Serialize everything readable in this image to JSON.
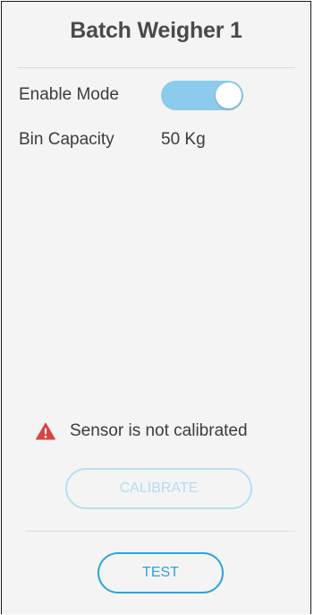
{
  "panel": {
    "title": "Batch Weigher 1"
  },
  "settings": {
    "enable_mode": {
      "label": "Enable Mode",
      "enabled": true
    },
    "bin_capacity": {
      "label": "Bin Capacity",
      "value": "50 Kg"
    }
  },
  "status": {
    "icon": "warning-triangle-icon",
    "message": "Sensor is not calibrated"
  },
  "actions": {
    "calibrate_label": "CALIBRATE",
    "calibrate_enabled": false,
    "test_label": "TEST"
  },
  "colors": {
    "toggle_on": "#8ccbec",
    "warning": "#d64541",
    "accent": "#2ea3dc",
    "disabled_accent": "#b8dff3"
  }
}
